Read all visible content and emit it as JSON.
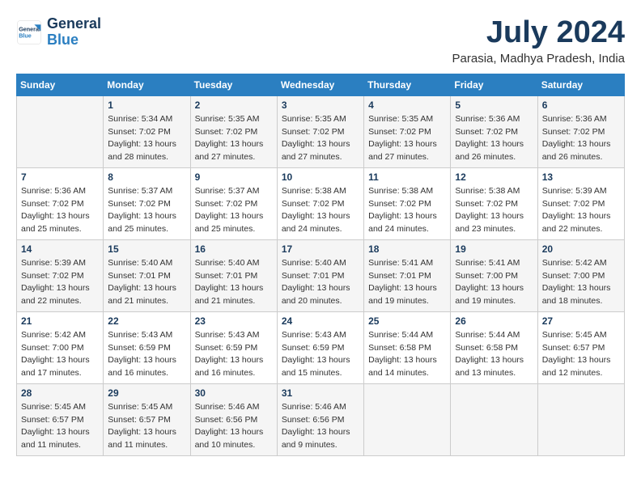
{
  "logo": {
    "line1": "General",
    "line2": "Blue"
  },
  "title": "July 2024",
  "location": "Parasia, Madhya Pradesh, India",
  "weekdays": [
    "Sunday",
    "Monday",
    "Tuesday",
    "Wednesday",
    "Thursday",
    "Friday",
    "Saturday"
  ],
  "weeks": [
    [
      {
        "day": "",
        "info": ""
      },
      {
        "day": "1",
        "info": "Sunrise: 5:34 AM\nSunset: 7:02 PM\nDaylight: 13 hours\nand 28 minutes."
      },
      {
        "day": "2",
        "info": "Sunrise: 5:35 AM\nSunset: 7:02 PM\nDaylight: 13 hours\nand 27 minutes."
      },
      {
        "day": "3",
        "info": "Sunrise: 5:35 AM\nSunset: 7:02 PM\nDaylight: 13 hours\nand 27 minutes."
      },
      {
        "day": "4",
        "info": "Sunrise: 5:35 AM\nSunset: 7:02 PM\nDaylight: 13 hours\nand 27 minutes."
      },
      {
        "day": "5",
        "info": "Sunrise: 5:36 AM\nSunset: 7:02 PM\nDaylight: 13 hours\nand 26 minutes."
      },
      {
        "day": "6",
        "info": "Sunrise: 5:36 AM\nSunset: 7:02 PM\nDaylight: 13 hours\nand 26 minutes."
      }
    ],
    [
      {
        "day": "7",
        "info": "Sunrise: 5:36 AM\nSunset: 7:02 PM\nDaylight: 13 hours\nand 25 minutes."
      },
      {
        "day": "8",
        "info": "Sunrise: 5:37 AM\nSunset: 7:02 PM\nDaylight: 13 hours\nand 25 minutes."
      },
      {
        "day": "9",
        "info": "Sunrise: 5:37 AM\nSunset: 7:02 PM\nDaylight: 13 hours\nand 25 minutes."
      },
      {
        "day": "10",
        "info": "Sunrise: 5:38 AM\nSunset: 7:02 PM\nDaylight: 13 hours\nand 24 minutes."
      },
      {
        "day": "11",
        "info": "Sunrise: 5:38 AM\nSunset: 7:02 PM\nDaylight: 13 hours\nand 24 minutes."
      },
      {
        "day": "12",
        "info": "Sunrise: 5:38 AM\nSunset: 7:02 PM\nDaylight: 13 hours\nand 23 minutes."
      },
      {
        "day": "13",
        "info": "Sunrise: 5:39 AM\nSunset: 7:02 PM\nDaylight: 13 hours\nand 22 minutes."
      }
    ],
    [
      {
        "day": "14",
        "info": "Sunrise: 5:39 AM\nSunset: 7:02 PM\nDaylight: 13 hours\nand 22 minutes."
      },
      {
        "day": "15",
        "info": "Sunrise: 5:40 AM\nSunset: 7:01 PM\nDaylight: 13 hours\nand 21 minutes."
      },
      {
        "day": "16",
        "info": "Sunrise: 5:40 AM\nSunset: 7:01 PM\nDaylight: 13 hours\nand 21 minutes."
      },
      {
        "day": "17",
        "info": "Sunrise: 5:40 AM\nSunset: 7:01 PM\nDaylight: 13 hours\nand 20 minutes."
      },
      {
        "day": "18",
        "info": "Sunrise: 5:41 AM\nSunset: 7:01 PM\nDaylight: 13 hours\nand 19 minutes."
      },
      {
        "day": "19",
        "info": "Sunrise: 5:41 AM\nSunset: 7:00 PM\nDaylight: 13 hours\nand 19 minutes."
      },
      {
        "day": "20",
        "info": "Sunrise: 5:42 AM\nSunset: 7:00 PM\nDaylight: 13 hours\nand 18 minutes."
      }
    ],
    [
      {
        "day": "21",
        "info": "Sunrise: 5:42 AM\nSunset: 7:00 PM\nDaylight: 13 hours\nand 17 minutes."
      },
      {
        "day": "22",
        "info": "Sunrise: 5:43 AM\nSunset: 6:59 PM\nDaylight: 13 hours\nand 16 minutes."
      },
      {
        "day": "23",
        "info": "Sunrise: 5:43 AM\nSunset: 6:59 PM\nDaylight: 13 hours\nand 16 minutes."
      },
      {
        "day": "24",
        "info": "Sunrise: 5:43 AM\nSunset: 6:59 PM\nDaylight: 13 hours\nand 15 minutes."
      },
      {
        "day": "25",
        "info": "Sunrise: 5:44 AM\nSunset: 6:58 PM\nDaylight: 13 hours\nand 14 minutes."
      },
      {
        "day": "26",
        "info": "Sunrise: 5:44 AM\nSunset: 6:58 PM\nDaylight: 13 hours\nand 13 minutes."
      },
      {
        "day": "27",
        "info": "Sunrise: 5:45 AM\nSunset: 6:57 PM\nDaylight: 13 hours\nand 12 minutes."
      }
    ],
    [
      {
        "day": "28",
        "info": "Sunrise: 5:45 AM\nSunset: 6:57 PM\nDaylight: 13 hours\nand 11 minutes."
      },
      {
        "day": "29",
        "info": "Sunrise: 5:45 AM\nSunset: 6:57 PM\nDaylight: 13 hours\nand 11 minutes."
      },
      {
        "day": "30",
        "info": "Sunrise: 5:46 AM\nSunset: 6:56 PM\nDaylight: 13 hours\nand 10 minutes."
      },
      {
        "day": "31",
        "info": "Sunrise: 5:46 AM\nSunset: 6:56 PM\nDaylight: 13 hours\nand 9 minutes."
      },
      {
        "day": "",
        "info": ""
      },
      {
        "day": "",
        "info": ""
      },
      {
        "day": "",
        "info": ""
      }
    ]
  ]
}
